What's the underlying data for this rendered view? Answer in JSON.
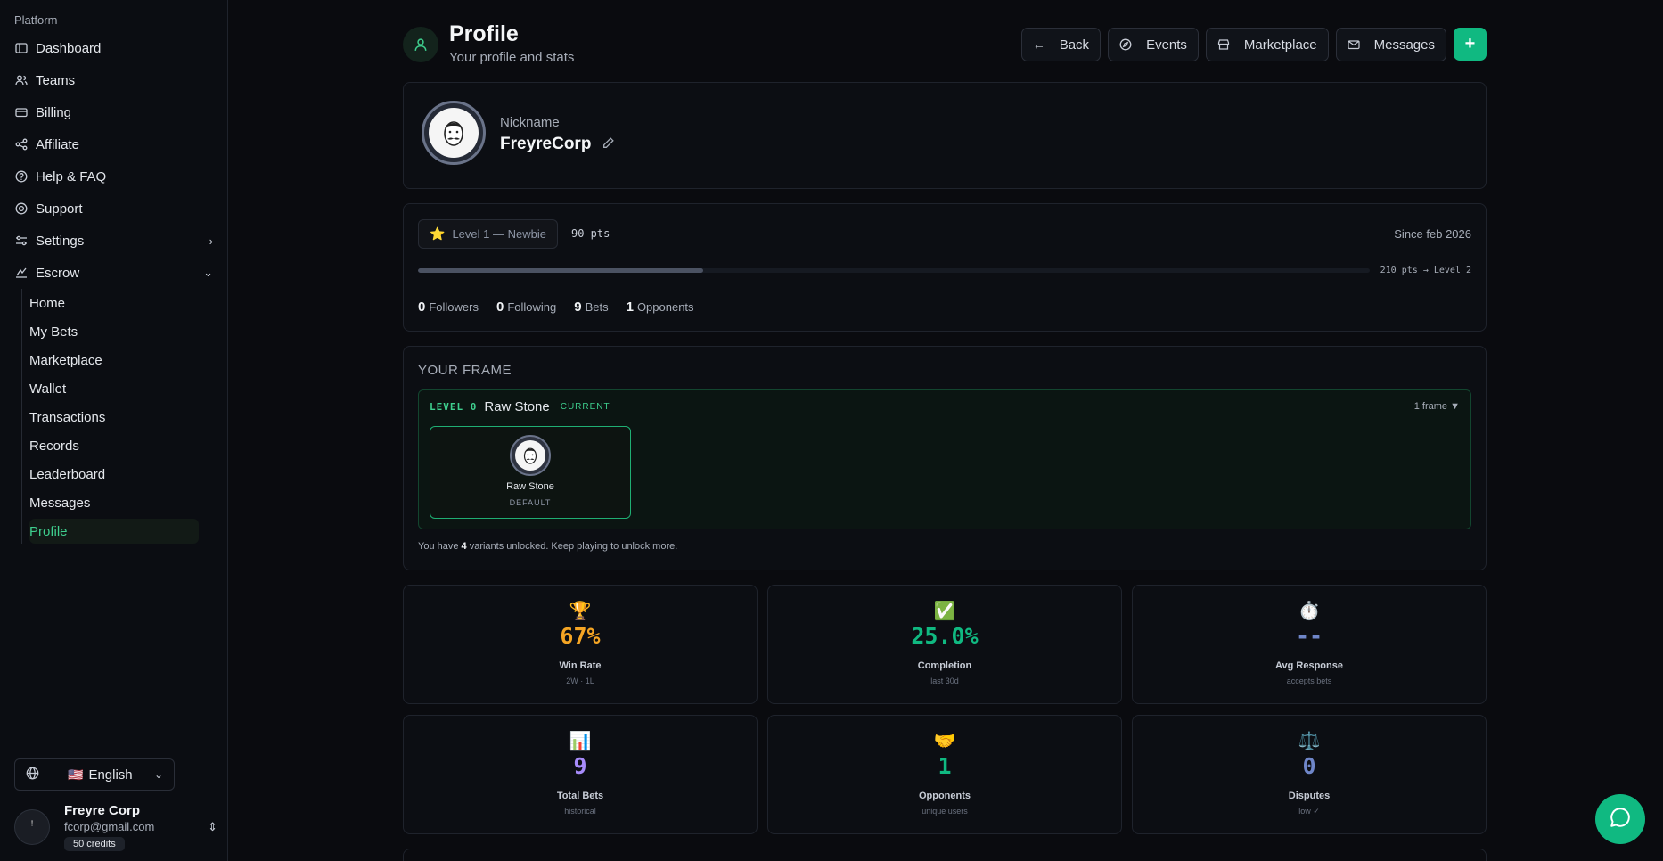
{
  "sidebar": {
    "section_label": "Platform",
    "items": [
      {
        "label": "Dashboard",
        "icon": "dashboard-icon"
      },
      {
        "label": "Teams",
        "icon": "users-icon"
      },
      {
        "label": "Billing",
        "icon": "credit-card-icon"
      },
      {
        "label": "Affiliate",
        "icon": "share-icon"
      },
      {
        "label": "Help & FAQ",
        "icon": "help-circle-icon"
      },
      {
        "label": "Support",
        "icon": "life-buoy-icon"
      },
      {
        "label": "Settings",
        "icon": "sliders-icon"
      },
      {
        "label": "Escrow",
        "icon": "scale-icon"
      }
    ],
    "escrow_sub": [
      "Home",
      "My Bets",
      "Marketplace",
      "Wallet",
      "Transactions",
      "Records",
      "Leaderboard",
      "Messages",
      "Profile"
    ],
    "active_sub": "Profile",
    "language": {
      "flag": "🇺🇸",
      "label": "English"
    },
    "user": {
      "name": "Freyre Corp",
      "email": "fcorp@gmail.com",
      "credits": "50 credits"
    }
  },
  "header": {
    "title": "Profile",
    "subtitle": "Your profile and stats",
    "buttons": {
      "back": "Back",
      "events": "Events",
      "marketplace": "Marketplace",
      "messages": "Messages"
    }
  },
  "profile": {
    "nickname_label": "Nickname",
    "nickname": "FreyreCorp"
  },
  "level": {
    "badge": "Level 1 — Newbie",
    "points": "90 pts",
    "since": "Since feb 2026",
    "progress": 0.3,
    "next": "210 pts → Level 2",
    "stats": [
      {
        "value": "0",
        "label": "Followers"
      },
      {
        "value": "0",
        "label": "Following"
      },
      {
        "value": "9",
        "label": "Bets"
      },
      {
        "value": "1",
        "label": "Opponents"
      }
    ]
  },
  "frame": {
    "title": "YOUR FRAME",
    "level_tag": "LEVEL 0",
    "name": "Raw Stone",
    "current": "CURRENT",
    "count": "1 frame ▼",
    "tile_name": "Raw Stone",
    "tile_tag": "DEFAULT",
    "note_prefix": "You have ",
    "note_count": "4",
    "note_suffix": " variants unlocked. Keep playing to unlock more."
  },
  "stat_cards": [
    {
      "emoji": "🏆",
      "value": "67%",
      "label": "Win Rate",
      "sub": "2W · 1L",
      "color": "#f5a524"
    },
    {
      "emoji": "✅",
      "value": "25.0%",
      "label": "Completion",
      "sub": "last 30d",
      "color": "#10b981"
    },
    {
      "emoji": "⏱️",
      "value": "--",
      "label": "Avg Response",
      "sub": "accepts bets",
      "color": "#6f86c9"
    },
    {
      "emoji": "📊",
      "value": "9",
      "label": "Total Bets",
      "sub": "historical",
      "color": "#a78bfa"
    },
    {
      "emoji": "🤝",
      "value": "1",
      "label": "Opponents",
      "sub": "unique users",
      "color": "#10b981"
    },
    {
      "emoji": "⚖️",
      "value": "0",
      "label": "Disputes",
      "sub": "low ✓",
      "color": "#6f86c9"
    }
  ]
}
